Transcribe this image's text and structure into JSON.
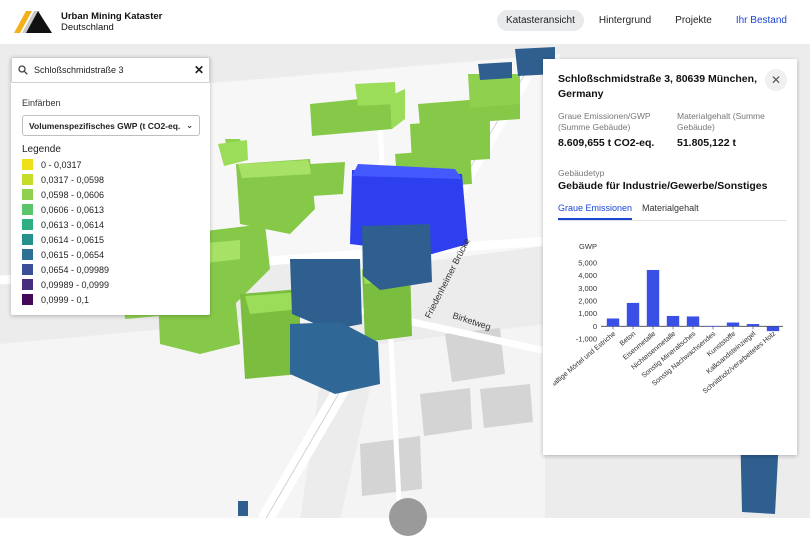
{
  "header": {
    "title": "Urban Mining Kataster",
    "subtitle": "Deutschland",
    "nav": [
      {
        "label": "Katasteransicht",
        "active": true
      },
      {
        "label": "Hintergrund",
        "active": false
      },
      {
        "label": "Projekte",
        "active": false
      },
      {
        "label": "Ihr Bestand",
        "active": false
      }
    ]
  },
  "search": {
    "value": "Schloßschmidstraße 3",
    "icon": "search-icon",
    "clear_icon": "close-icon"
  },
  "colorize": {
    "label": "Einfärben",
    "selected": "Volumenspezifisches GWP (t CO2-eq.",
    "legend_title": "Legende",
    "legend": [
      {
        "range": "0 - 0,0317",
        "color": "#f0e01a"
      },
      {
        "range": "0,0317 - 0,0598",
        "color": "#c5dc2b"
      },
      {
        "range": "0,0598 - 0,0606",
        "color": "#8fd14f"
      },
      {
        "range": "0,0606 - 0,0613",
        "color": "#5bc56a"
      },
      {
        "range": "0,0613 - 0,0614",
        "color": "#2fae82"
      },
      {
        "range": "0,0614 - 0,0615",
        "color": "#26908d"
      },
      {
        "range": "0,0615 - 0,0654",
        "color": "#2e6f95"
      },
      {
        "range": "0,0654 - 0,09989",
        "color": "#3b4f96"
      },
      {
        "range": "0,09989 - 0,0999",
        "color": "#472e7c"
      },
      {
        "range": "0,0999 - 0,1",
        "color": "#45095a"
      }
    ]
  },
  "map": {
    "street_labels": [
      "Friedenheimer Brücke",
      "Birketweg"
    ]
  },
  "detail": {
    "address": "Schloßschmidstraße 3, 80639 München, Germany",
    "gwp_label": "Graue Emissionen/GWP (Summe Gebäude)",
    "gwp_value": "8.609,655 t CO2-eq.",
    "material_label": "Materialgehalt (Summe Gebäude)",
    "material_value": "51.805,122 t",
    "type_label": "Gebäudetyp",
    "type_value": "Gebäude für Industrie/Gewerbe/Sonstiges",
    "tabs": [
      {
        "label": "Graue Emissionen",
        "active": true
      },
      {
        "label": "Materialgehalt",
        "active": false
      }
    ]
  },
  "chart_data": {
    "type": "bar",
    "ylabel": "GWP",
    "ylim": [
      -1000,
      5000
    ],
    "yticks": [
      "5,000",
      "4,000",
      "3,000",
      "2,000",
      "1,000",
      "0",
      "-1,000"
    ],
    "ytick_values": [
      5000,
      4000,
      3000,
      2000,
      1000,
      0,
      -1000
    ],
    "categories": [
      "Kalkhaltige Mörtel und Estriche",
      "Beton",
      "Eisenmetalle",
      "Nichteisenmetalle",
      "Sonstig Mineralisches",
      "Sonstig Nachwachsendes",
      "Kunststoffe",
      "Kalksandsteinziegel",
      "Schnittholz/verarbeitetes Holz"
    ],
    "values": [
      620,
      1850,
      4450,
      820,
      780,
      30,
      300,
      180,
      -380
    ],
    "bar_color": "#3a4fe6",
    "grid": false
  }
}
